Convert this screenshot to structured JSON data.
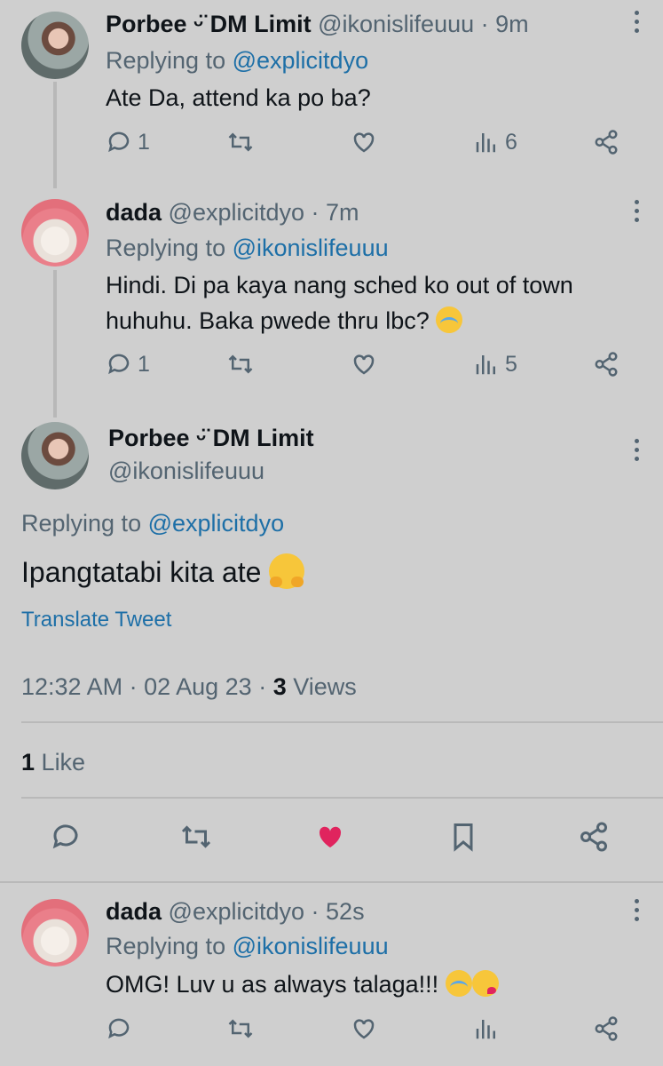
{
  "tweets": [
    {
      "name": "Porbee ᵕ̈ DM Limit",
      "handle": "@ikonislifeuuu",
      "time": "· 9m",
      "replying_label": "Replying to",
      "replying_to": "@explicitdyo",
      "text": "Ate Da, attend ka po ba?",
      "replies": "1",
      "views": "6"
    },
    {
      "name": "dada",
      "handle": "@explicitdyo",
      "time": "· 7m",
      "replying_label": "Replying to",
      "replying_to": "@ikonislifeuuu",
      "text_line1": "Hindi. Di pa kaya nang sched ko out of town",
      "text_line2": "huhuhu. Baka pwede thru lbc?",
      "replies": "1",
      "views": "5"
    }
  ],
  "main": {
    "name": "Porbee ᵕ̈ DM Limit",
    "handle": "@ikonislifeuuu",
    "replying_label": "Replying to",
    "replying_to": "@explicitdyo",
    "text": "Ipangtatabi kita ate",
    "translate": "Translate Tweet",
    "timestamp": "12:32 AM · 02 Aug 23 ·",
    "views_count": "3",
    "views_label": "Views",
    "likes_count": "1",
    "likes_label": "Like"
  },
  "reply": {
    "name": "dada",
    "handle": "@explicitdyo",
    "time": "· 52s",
    "replying_label": "Replying to",
    "replying_to": "@ikonislifeuuu",
    "text": "OMG! Luv u as always talaga!!!"
  },
  "colors": {
    "link": "#1d6fa7",
    "like_active": "#e0245e",
    "muted": "#536471"
  }
}
